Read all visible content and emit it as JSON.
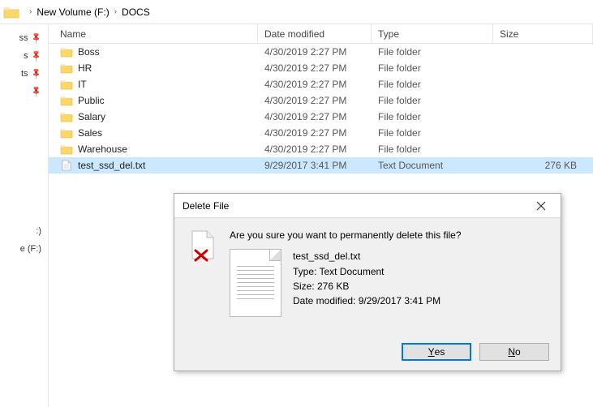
{
  "breadcrumb": {
    "drive": "New Volume (F:)",
    "folder": "DOCS"
  },
  "columns": {
    "name": "Name",
    "date": "Date modified",
    "type": "Type",
    "size": "Size"
  },
  "rows": [
    {
      "name": "Boss",
      "date": "4/30/2019 2:27 PM",
      "type": "File folder",
      "size": "",
      "icon": "folder"
    },
    {
      "name": "HR",
      "date": "4/30/2019 2:27 PM",
      "type": "File folder",
      "size": "",
      "icon": "folder"
    },
    {
      "name": "IT",
      "date": "4/30/2019 2:27 PM",
      "type": "File folder",
      "size": "",
      "icon": "folder"
    },
    {
      "name": "Public",
      "date": "4/30/2019 2:27 PM",
      "type": "File folder",
      "size": "",
      "icon": "folder"
    },
    {
      "name": "Salary",
      "date": "4/30/2019 2:27 PM",
      "type": "File folder",
      "size": "",
      "icon": "folder"
    },
    {
      "name": "Sales",
      "date": "4/30/2019 2:27 PM",
      "type": "File folder",
      "size": "",
      "icon": "folder"
    },
    {
      "name": "Warehouse",
      "date": "4/30/2019 2:27 PM",
      "type": "File folder",
      "size": "",
      "icon": "folder"
    },
    {
      "name": "test_ssd_del.txt",
      "date": "9/29/2017 3:41 PM",
      "type": "Text Document",
      "size": "276 KB",
      "icon": "txt",
      "selected": true
    }
  ],
  "nav": {
    "item1": "ss",
    "item2": "s",
    "item3": "ts",
    "item4": ":)",
    "item5": "e (F:)"
  },
  "dialog": {
    "title": "Delete File",
    "question": "Are you sure you want to permanently delete this file?",
    "filename": "test_ssd_del.txt",
    "type_label": "Type: Text Document",
    "size_label": "Size: 276 KB",
    "date_label": "Date modified: 9/29/2017 3:41 PM",
    "yes": "Yes",
    "no": "No"
  }
}
